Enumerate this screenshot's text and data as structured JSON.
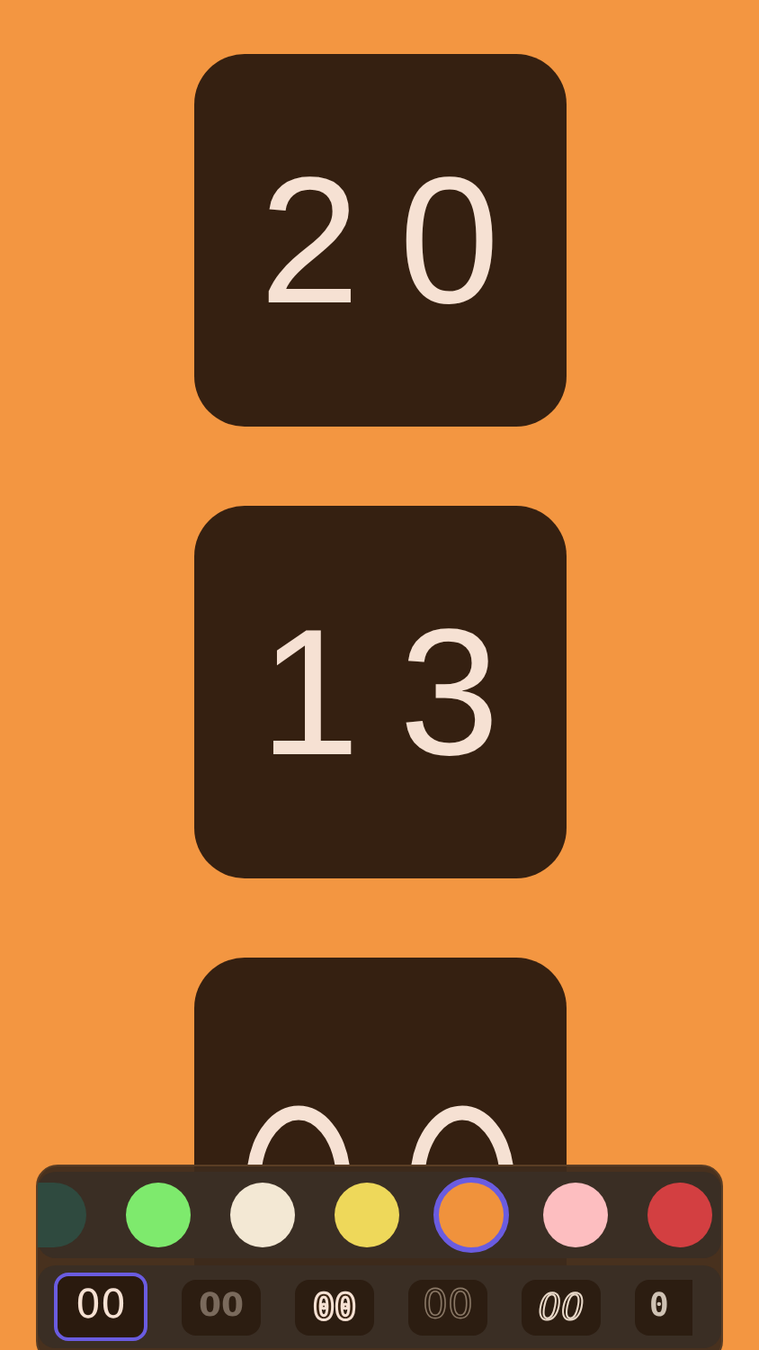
{
  "clock": [
    {
      "digits": "20"
    },
    {
      "digits": "13"
    }
  ],
  "colors": [
    {
      "color": "#2f4a3f",
      "selected": false,
      "clipped": true
    },
    {
      "color": "#7eea6d",
      "selected": false,
      "clipped": false
    },
    {
      "color": "#f3e8d4",
      "selected": false,
      "clipped": false
    },
    {
      "color": "#eed85a",
      "selected": false,
      "clipped": false
    },
    {
      "color": "#f0923c",
      "selected": true,
      "clipped": false
    },
    {
      "color": "#fdbec0",
      "selected": false,
      "clipped": false
    },
    {
      "color": "#d33f41",
      "selected": false,
      "clipped": false
    }
  ],
  "styles": [
    {
      "kind": "thin",
      "label": "00",
      "selected": true
    },
    {
      "kind": "heavy",
      "label": "00",
      "selected": false
    },
    {
      "kind": "block",
      "label": "00",
      "selected": false
    },
    {
      "kind": "outline",
      "label": "00",
      "selected": false
    },
    {
      "kind": "sketch",
      "label": "00",
      "selected": false
    },
    {
      "kind": "dotted",
      "label": "0",
      "selected": false
    }
  ]
}
